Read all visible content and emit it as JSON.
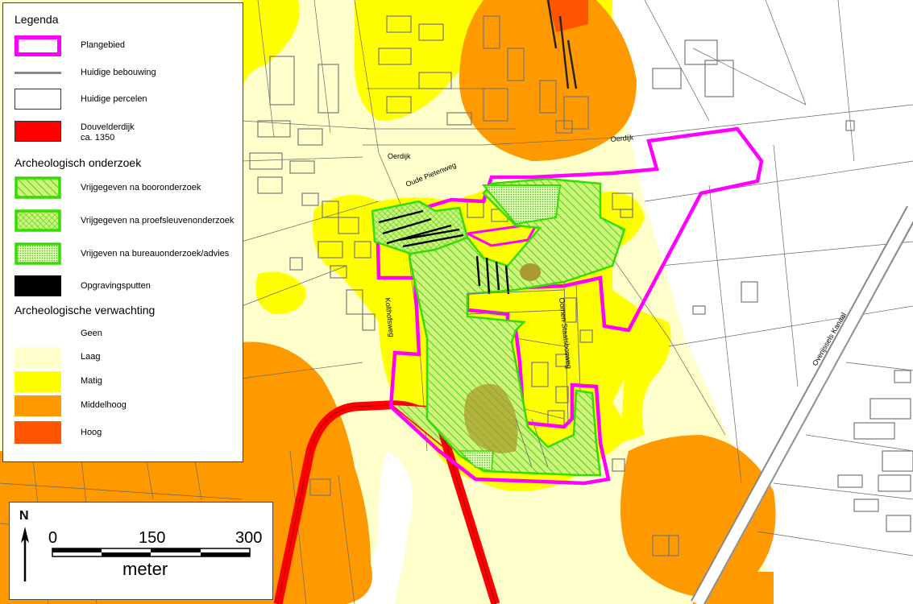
{
  "map": {
    "street_labels": [
      {
        "name": "oerdijk-west",
        "text": "Oerdijk"
      },
      {
        "name": "oerdijk-east",
        "text": "Oerdijk"
      },
      {
        "name": "oude-pietenweg",
        "text": "Oude Pietenweg"
      },
      {
        "name": "kolthofsweg",
        "text": "Kolthofsweg"
      },
      {
        "name": "oude-straat",
        "text": "Oomen Staatsbosweg"
      },
      {
        "name": "kanaal",
        "text": "Overijssels Kanaal"
      }
    ]
  },
  "legend": {
    "title": "Legenda",
    "items_top": [
      {
        "label": "Plangebied",
        "swatch": "outline-magenta"
      },
      {
        "label": "Huidige bebouwing",
        "swatch": "line-gray"
      },
      {
        "label": "Huidige percelen",
        "swatch": "box-white"
      },
      {
        "label": "Douvelderdijk\nca. 1350",
        "swatch": "box-red"
      }
    ],
    "section_onderzoek": "Archeologisch onderzoek",
    "items_onderzoek": [
      {
        "label": "Vrijgegeven na booronderzoek",
        "swatch": "hatch-diag"
      },
      {
        "label": "Vrijgegeven na proefsleuvenonderzoek",
        "swatch": "hatch-cross"
      },
      {
        "label": "Vrijgeven na bureauonderzoek/advies",
        "swatch": "hatch-dots"
      },
      {
        "label": "Opgravingsputten",
        "swatch": "box-black"
      }
    ],
    "section_verwachting": "Archeologische verwachting",
    "items_verwachting": [
      {
        "label": "Geen",
        "color": "#ffffff"
      },
      {
        "label": "Laag",
        "color": "#ffffcc"
      },
      {
        "label": "Matig",
        "color": "#ffff00"
      },
      {
        "label": "Middelhoog",
        "color": "#ff9900"
      },
      {
        "label": "Hoog",
        "color": "#ff5500"
      }
    ]
  },
  "scalebar": {
    "north": "N",
    "ticks": [
      "0",
      "150",
      "300"
    ],
    "unit": "meter"
  },
  "colors": {
    "plangebied": "#ff00ff",
    "dijk": "#ff0000",
    "laag": "#ffffcc",
    "matig": "#ffff00",
    "middelhoog": "#ff9900",
    "hoog": "#ff5500",
    "green_hatch": "#33cc00"
  }
}
